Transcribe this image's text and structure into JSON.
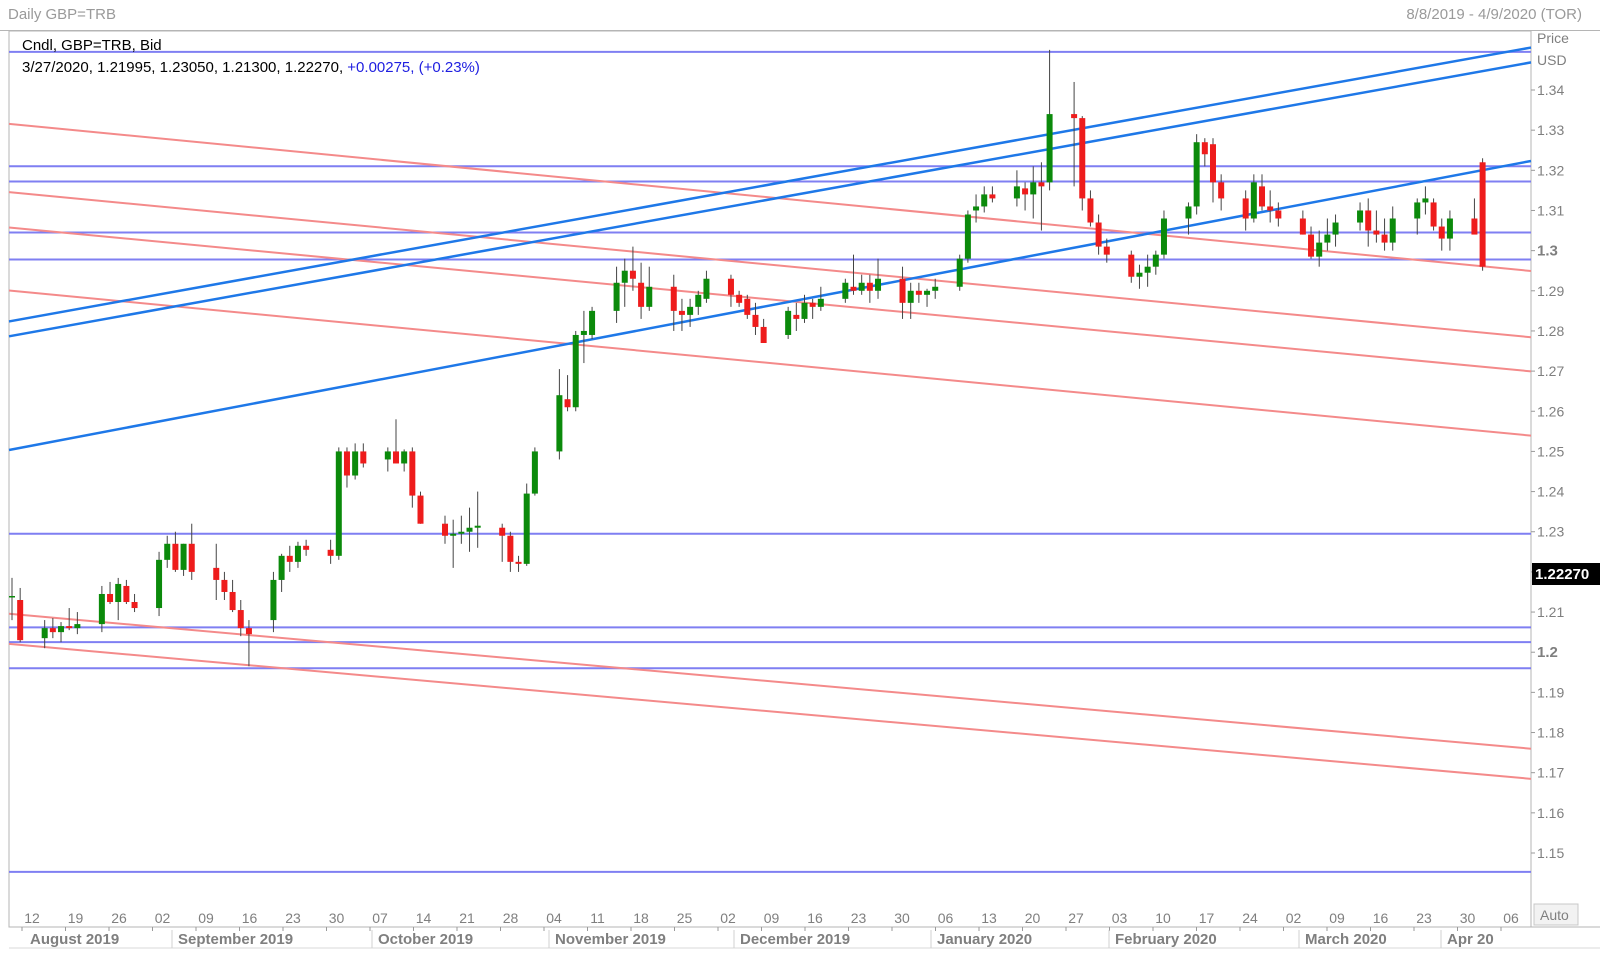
{
  "window": {
    "title": "Daily GBP=TRB",
    "range": "8/8/2019 - 4/9/2020 (TOR)"
  },
  "legend": {
    "line1": "Cndl, GBP=TRB, Bid",
    "line2_prefix": "3/27/2020, 1.21995, 1.23050, 1.21300, 1.22270, ",
    "change": "+0.00275, (+0.23%)"
  },
  "price_axis": {
    "label1": "Price",
    "label2": "USD",
    "auto": "Auto",
    "last_value": "1.22270"
  },
  "colors": {
    "up": "#0b8a0b",
    "down": "#ee1c1c",
    "blue_line": "#1e78e8",
    "pink_line": "#f48a8a",
    "hline": "#7f7ff2",
    "axis_text": "#7f7f7f"
  },
  "chart_data": {
    "type": "candlestick",
    "title": "Daily GBP=TRB",
    "x_range": [
      "8/8/2019",
      "4/9/2020"
    ],
    "ylim": [
      1.14,
      1.355
    ],
    "y_ticks": [
      "1.15",
      "1.16",
      "1.17",
      "1.18",
      "1.19",
      "1.2",
      "1.21",
      "1.22",
      "1.23",
      "1.24",
      "1.25",
      "1.26",
      "1.27",
      "1.28",
      "1.29",
      "1.3",
      "1.31",
      "1.32",
      "1.33",
      "1.34"
    ],
    "major_ticks": [
      "1.2",
      "1.3"
    ],
    "day_ticks": [
      "12",
      "19",
      "26",
      "02",
      "09",
      "16",
      "23",
      "30",
      "07",
      "14",
      "21",
      "28",
      "04",
      "11",
      "18",
      "25",
      "02",
      "09",
      "16",
      "23",
      "30",
      "06",
      "13",
      "20",
      "27",
      "03",
      "10",
      "17",
      "24",
      "02",
      "09",
      "16",
      "23",
      "30",
      "06"
    ],
    "months": [
      "August 2019",
      "September 2019",
      "October 2019",
      "November 2019",
      "December 2019",
      "January 2020",
      "February 2020",
      "March 2020",
      "Apr 20"
    ],
    "horizontal_lines": [
      1.3495,
      1.321,
      1.3172,
      1.3045,
      1.2978,
      1.2295,
      1.2062,
      1.2025,
      1.196,
      1.1453
    ],
    "trend_lines_blue": [
      [
        [
          0,
          1.2825
        ],
        [
          183,
          1.3495
        ]
      ],
      [
        [
          0,
          1.2788
        ],
        [
          183,
          1.3458
        ]
      ],
      [
        [
          0,
          1.2505
        ],
        [
          183,
          1.3212
        ]
      ]
    ],
    "trend_lines_pink": [
      [
        [
          0,
          1.3315
        ],
        [
          183,
          1.2955
        ]
      ],
      [
        [
          0,
          1.3145
        ],
        [
          183,
          1.279
        ]
      ],
      [
        [
          0,
          1.3057
        ],
        [
          183,
          1.2705
        ]
      ],
      [
        [
          0,
          1.29
        ],
        [
          183,
          1.2545
        ]
      ],
      [
        [
          0,
          1.2095
        ],
        [
          183,
          1.1765
        ]
      ],
      [
        [
          0,
          1.202
        ],
        [
          183,
          1.169
        ]
      ]
    ],
    "candles": [
      {
        "d": 0,
        "o": 1.214,
        "h": 1.2185,
        "l": 1.208,
        "c": 1.214
      },
      {
        "d": 1,
        "o": 1.213,
        "h": 1.216,
        "l": 1.2025,
        "c": 1.203
      },
      {
        "d": 4,
        "o": 1.2035,
        "h": 1.208,
        "l": 1.201,
        "c": 1.206
      },
      {
        "d": 5,
        "o": 1.206,
        "h": 1.2085,
        "l": 1.2035,
        "c": 1.205
      },
      {
        "d": 6,
        "o": 1.205,
        "h": 1.2075,
        "l": 1.2025,
        "c": 1.2065
      },
      {
        "d": 7,
        "o": 1.2065,
        "h": 1.211,
        "l": 1.2055,
        "c": 1.206
      },
      {
        "d": 8,
        "o": 1.206,
        "h": 1.21,
        "l": 1.2045,
        "c": 1.207
      },
      {
        "d": 11,
        "o": 1.207,
        "h": 1.2165,
        "l": 1.205,
        "c": 1.2145
      },
      {
        "d": 12,
        "o": 1.2145,
        "h": 1.2175,
        "l": 1.212,
        "c": 1.2125
      },
      {
        "d": 13,
        "o": 1.2125,
        "h": 1.2185,
        "l": 1.208,
        "c": 1.217
      },
      {
        "d": 14,
        "o": 1.2165,
        "h": 1.218,
        "l": 1.212,
        "c": 1.2125
      },
      {
        "d": 15,
        "o": 1.2125,
        "h": 1.2145,
        "l": 1.21,
        "c": 1.211
      },
      {
        "d": 18,
        "o": 1.211,
        "h": 1.225,
        "l": 1.209,
        "c": 1.223
      },
      {
        "d": 19,
        "o": 1.223,
        "h": 1.229,
        "l": 1.221,
        "c": 1.227
      },
      {
        "d": 20,
        "o": 1.227,
        "h": 1.23,
        "l": 1.22,
        "c": 1.2205
      },
      {
        "d": 21,
        "o": 1.2205,
        "h": 1.227,
        "l": 1.219,
        "c": 1.227
      },
      {
        "d": 22,
        "o": 1.227,
        "h": 1.232,
        "l": 1.218,
        "c": 1.22
      },
      {
        "d": 25,
        "o": 1.221,
        "h": 1.227,
        "l": 1.213,
        "c": 1.218
      },
      {
        "d": 26,
        "o": 1.218,
        "h": 1.22,
        "l": 1.213,
        "c": 1.215
      },
      {
        "d": 27,
        "o": 1.215,
        "h": 1.218,
        "l": 1.21,
        "c": 1.2105
      },
      {
        "d": 28,
        "o": 1.2105,
        "h": 1.213,
        "l": 1.204,
        "c": 1.206
      },
      {
        "d": 29,
        "o": 1.206,
        "h": 1.208,
        "l": 1.1965,
        "c": 1.2045
      },
      {
        "d": 32,
        "o": 1.208,
        "h": 1.22,
        "l": 1.205,
        "c": 1.218
      },
      {
        "d": 33,
        "o": 1.218,
        "h": 1.2245,
        "l": 1.215,
        "c": 1.224
      },
      {
        "d": 34,
        "o": 1.224,
        "h": 1.2265,
        "l": 1.22,
        "c": 1.2225
      },
      {
        "d": 35,
        "o": 1.2225,
        "h": 1.2275,
        "l": 1.221,
        "c": 1.2265
      },
      {
        "d": 36,
        "o": 1.2265,
        "h": 1.228,
        "l": 1.224,
        "c": 1.2255
      },
      {
        "d": 39,
        "o": 1.2255,
        "h": 1.228,
        "l": 1.222,
        "c": 1.224
      },
      {
        "d": 40,
        "o": 1.224,
        "h": 1.251,
        "l": 1.223,
        "c": 1.25
      },
      {
        "d": 41,
        "o": 1.25,
        "h": 1.251,
        "l": 1.241,
        "c": 1.244
      },
      {
        "d": 42,
        "o": 1.244,
        "h": 1.252,
        "l": 1.243,
        "c": 1.25
      },
      {
        "d": 43,
        "o": 1.25,
        "h": 1.252,
        "l": 1.246,
        "c": 1.247
      },
      {
        "d": 46,
        "o": 1.248,
        "h": 1.251,
        "l": 1.245,
        "c": 1.25
      },
      {
        "d": 47,
        "o": 1.25,
        "h": 1.258,
        "l": 1.247,
        "c": 1.247
      },
      {
        "d": 48,
        "o": 1.247,
        "h": 1.2505,
        "l": 1.245,
        "c": 1.25
      },
      {
        "d": 49,
        "o": 1.25,
        "h": 1.251,
        "l": 1.236,
        "c": 1.239
      },
      {
        "d": 50,
        "o": 1.239,
        "h": 1.24,
        "l": 1.232,
        "c": 1.232
      },
      {
        "d": 53,
        "o": 1.232,
        "h": 1.234,
        "l": 1.227,
        "c": 1.229
      },
      {
        "d": 54,
        "o": 1.229,
        "h": 1.233,
        "l": 1.221,
        "c": 1.2295
      },
      {
        "d": 55,
        "o": 1.2295,
        "h": 1.234,
        "l": 1.227,
        "c": 1.23
      },
      {
        "d": 56,
        "o": 1.23,
        "h": 1.236,
        "l": 1.225,
        "c": 1.231
      },
      {
        "d": 57,
        "o": 1.231,
        "h": 1.24,
        "l": 1.226,
        "c": 1.2315
      },
      {
        "d": 60,
        "o": 1.231,
        "h": 1.232,
        "l": 1.2225,
        "c": 1.229
      },
      {
        "d": 61,
        "o": 1.229,
        "h": 1.23,
        "l": 1.22,
        "c": 1.2225
      },
      {
        "d": 62,
        "o": 1.2225,
        "h": 1.224,
        "l": 1.22,
        "c": 1.222
      },
      {
        "d": 63,
        "o": 1.222,
        "h": 1.242,
        "l": 1.2215,
        "c": 1.2395
      },
      {
        "d": 64,
        "o": 1.2395,
        "h": 1.251,
        "l": 1.239,
        "c": 1.25
      },
      {
        "d": 67,
        "o": 1.25,
        "h": 1.2705,
        "l": 1.248,
        "c": 1.264
      },
      {
        "d": 68,
        "o": 1.263,
        "h": 1.269,
        "l": 1.26,
        "c": 1.261
      },
      {
        "d": 69,
        "o": 1.261,
        "h": 1.28,
        "l": 1.26,
        "c": 1.279
      },
      {
        "d": 70,
        "o": 1.279,
        "h": 1.285,
        "l": 1.272,
        "c": 1.28
      },
      {
        "d": 71,
        "o": 1.279,
        "h": 1.286,
        "l": 1.278,
        "c": 1.285
      },
      {
        "d": 74,
        "o": 1.285,
        "h": 1.296,
        "l": 1.282,
        "c": 1.292
      },
      {
        "d": 75,
        "o": 1.292,
        "h": 1.298,
        "l": 1.286,
        "c": 1.295
      },
      {
        "d": 76,
        "o": 1.295,
        "h": 1.301,
        "l": 1.29,
        "c": 1.293
      },
      {
        "d": 77,
        "o": 1.292,
        "h": 1.297,
        "l": 1.283,
        "c": 1.286
      },
      {
        "d": 78,
        "o": 1.286,
        "h": 1.296,
        "l": 1.285,
        "c": 1.291
      },
      {
        "d": 81,
        "o": 1.291,
        "h": 1.294,
        "l": 1.28,
        "c": 1.285
      },
      {
        "d": 82,
        "o": 1.285,
        "h": 1.288,
        "l": 1.28,
        "c": 1.284
      },
      {
        "d": 83,
        "o": 1.284,
        "h": 1.288,
        "l": 1.281,
        "c": 1.286
      },
      {
        "d": 84,
        "o": 1.286,
        "h": 1.29,
        "l": 1.284,
        "c": 1.289
      },
      {
        "d": 85,
        "o": 1.288,
        "h": 1.295,
        "l": 1.287,
        "c": 1.293
      },
      {
        "d": 88,
        "o": 1.293,
        "h": 1.294,
        "l": 1.286,
        "c": 1.289
      },
      {
        "d": 89,
        "o": 1.289,
        "h": 1.29,
        "l": 1.286,
        "c": 1.287
      },
      {
        "d": 90,
        "o": 1.288,
        "h": 1.289,
        "l": 1.283,
        "c": 1.284
      },
      {
        "d": 91,
        "o": 1.284,
        "h": 1.287,
        "l": 1.279,
        "c": 1.281
      },
      {
        "d": 92,
        "o": 1.281,
        "h": 1.283,
        "l": 1.277,
        "c": 1.277
      },
      {
        "d": 95,
        "o": 1.279,
        "h": 1.286,
        "l": 1.278,
        "c": 1.285
      },
      {
        "d": 96,
        "o": 1.284,
        "h": 1.287,
        "l": 1.28,
        "c": 1.283
      },
      {
        "d": 97,
        "o": 1.283,
        "h": 1.289,
        "l": 1.282,
        "c": 1.287
      },
      {
        "d": 98,
        "o": 1.287,
        "h": 1.288,
        "l": 1.283,
        "c": 1.286
      },
      {
        "d": 99,
        "o": 1.286,
        "h": 1.291,
        "l": 1.285,
        "c": 1.288
      },
      {
        "d": 102,
        "o": 1.288,
        "h": 1.293,
        "l": 1.287,
        "c": 1.292
      },
      {
        "d": 103,
        "o": 1.291,
        "h": 1.299,
        "l": 1.289,
        "c": 1.29
      },
      {
        "d": 104,
        "o": 1.29,
        "h": 1.294,
        "l": 1.289,
        "c": 1.292
      },
      {
        "d": 105,
        "o": 1.292,
        "h": 1.294,
        "l": 1.287,
        "c": 1.29
      },
      {
        "d": 106,
        "o": 1.29,
        "h": 1.298,
        "l": 1.288,
        "c": 1.293
      },
      {
        "d": 109,
        "o": 1.293,
        "h": 1.296,
        "l": 1.283,
        "c": 1.287
      },
      {
        "d": 110,
        "o": 1.287,
        "h": 1.292,
        "l": 1.283,
        "c": 1.29
      },
      {
        "d": 111,
        "o": 1.29,
        "h": 1.292,
        "l": 1.287,
        "c": 1.289
      },
      {
        "d": 112,
        "o": 1.289,
        "h": 1.2905,
        "l": 1.286,
        "c": 1.29
      },
      {
        "d": 113,
        "o": 1.29,
        "h": 1.293,
        "l": 1.288,
        "c": 1.291
      },
      {
        "d": 116,
        "o": 1.291,
        "h": 1.299,
        "l": 1.29,
        "c": 1.298
      },
      {
        "d": 117,
        "o": 1.298,
        "h": 1.31,
        "l": 1.297,
        "c": 1.309
      },
      {
        "d": 118,
        "o": 1.31,
        "h": 1.314,
        "l": 1.307,
        "c": 1.311
      },
      {
        "d": 119,
        "o": 1.311,
        "h": 1.316,
        "l": 1.3095,
        "c": 1.314
      },
      {
        "d": 120,
        "o": 1.314,
        "h": 1.316,
        "l": 1.312,
        "c": 1.313
      },
      {
        "d": 123,
        "o": 1.313,
        "h": 1.32,
        "l": 1.311,
        "c": 1.316
      },
      {
        "d": 124,
        "o": 1.3155,
        "h": 1.317,
        "l": 1.31,
        "c": 1.314
      },
      {
        "d": 125,
        "o": 1.314,
        "h": 1.321,
        "l": 1.308,
        "c": 1.317
      },
      {
        "d": 126,
        "o": 1.317,
        "h": 1.322,
        "l": 1.305,
        "c": 1.316
      },
      {
        "d": 127,
        "o": 1.317,
        "h": 1.35,
        "l": 1.315,
        "c": 1.334
      },
      {
        "d": 130,
        "o": 1.334,
        "h": 1.342,
        "l": 1.316,
        "c": 1.333
      },
      {
        "d": 131,
        "o": 1.333,
        "h": 1.3335,
        "l": 1.31,
        "c": 1.313
      },
      {
        "d": 132,
        "o": 1.313,
        "h": 1.315,
        "l": 1.306,
        "c": 1.307
      },
      {
        "d": 133,
        "o": 1.307,
        "h": 1.309,
        "l": 1.299,
        "c": 1.301
      },
      {
        "d": 134,
        "o": 1.301,
        "h": 1.303,
        "l": 1.297,
        "c": 1.299
      },
      {
        "d": 137,
        "o": 1.299,
        "h": 1.3,
        "l": 1.292,
        "c": 1.2935
      },
      {
        "d": 138,
        "o": 1.2935,
        "h": 1.2965,
        "l": 1.2905,
        "c": 1.2945
      },
      {
        "d": 139,
        "o": 1.2945,
        "h": 1.299,
        "l": 1.291,
        "c": 1.296
      },
      {
        "d": 140,
        "o": 1.296,
        "h": 1.3,
        "l": 1.294,
        "c": 1.299
      },
      {
        "d": 141,
        "o": 1.299,
        "h": 1.31,
        "l": 1.298,
        "c": 1.308
      },
      {
        "d": 144,
        "o": 1.308,
        "h": 1.312,
        "l": 1.304,
        "c": 1.311
      },
      {
        "d": 145,
        "o": 1.311,
        "h": 1.329,
        "l": 1.309,
        "c": 1.327
      },
      {
        "d": 146,
        "o": 1.327,
        "h": 1.328,
        "l": 1.321,
        "c": 1.324
      },
      {
        "d": 147,
        "o": 1.3265,
        "h": 1.328,
        "l": 1.312,
        "c": 1.317
      },
      {
        "d": 148,
        "o": 1.317,
        "h": 1.319,
        "l": 1.31,
        "c": 1.313
      },
      {
        "d": 151,
        "o": 1.313,
        "h": 1.315,
        "l": 1.305,
        "c": 1.308
      },
      {
        "d": 152,
        "o": 1.308,
        "h": 1.319,
        "l": 1.307,
        "c": 1.317
      },
      {
        "d": 153,
        "o": 1.316,
        "h": 1.319,
        "l": 1.31,
        "c": 1.311
      },
      {
        "d": 154,
        "o": 1.311,
        "h": 1.315,
        "l": 1.307,
        "c": 1.31
      },
      {
        "d": 155,
        "o": 1.31,
        "h": 1.312,
        "l": 1.306,
        "c": 1.308
      },
      {
        "d": 158,
        "o": 1.308,
        "h": 1.31,
        "l": 1.304,
        "c": 1.304
      },
      {
        "d": 159,
        "o": 1.304,
        "h": 1.306,
        "l": 1.298,
        "c": 1.2985
      },
      {
        "d": 160,
        "o": 1.2985,
        "h": 1.305,
        "l": 1.296,
        "c": 1.302
      },
      {
        "d": 161,
        "o": 1.302,
        "h": 1.308,
        "l": 1.3,
        "c": 1.304
      },
      {
        "d": 162,
        "o": 1.304,
        "h": 1.309,
        "l": 1.301,
        "c": 1.307
      },
      {
        "d": 165,
        "o": 1.307,
        "h": 1.312,
        "l": 1.305,
        "c": 1.31
      },
      {
        "d": 166,
        "o": 1.31,
        "h": 1.313,
        "l": 1.301,
        "c": 1.305
      },
      {
        "d": 167,
        "o": 1.305,
        "h": 1.31,
        "l": 1.302,
        "c": 1.304
      },
      {
        "d": 168,
        "o": 1.304,
        "h": 1.308,
        "l": 1.3,
        "c": 1.302
      },
      {
        "d": 169,
        "o": 1.302,
        "h": 1.311,
        "l": 1.3,
        "c": 1.308
      },
      {
        "d": 172,
        "o": 1.308,
        "h": 1.313,
        "l": 1.304,
        "c": 1.312
      },
      {
        "d": 173,
        "o": 1.312,
        "h": 1.316,
        "l": 1.309,
        "c": 1.313
      },
      {
        "d": 174,
        "o": 1.312,
        "h": 1.313,
        "l": 1.305,
        "c": 1.306
      },
      {
        "d": 175,
        "o": 1.306,
        "h": 1.308,
        "l": 1.3,
        "c": 1.303
      },
      {
        "d": 176,
        "o": 1.303,
        "h": 1.31,
        "l": 1.3,
        "c": 1.308
      },
      {
        "d": 179,
        "o": 1.308,
        "h": 1.313,
        "l": 1.306,
        "c": 1.304
      },
      {
        "d": 180,
        "o": 1.322,
        "h": 1.323,
        "l": 1.295,
        "c": 1.296
      }
    ],
    "last_price": 1.2227
  }
}
